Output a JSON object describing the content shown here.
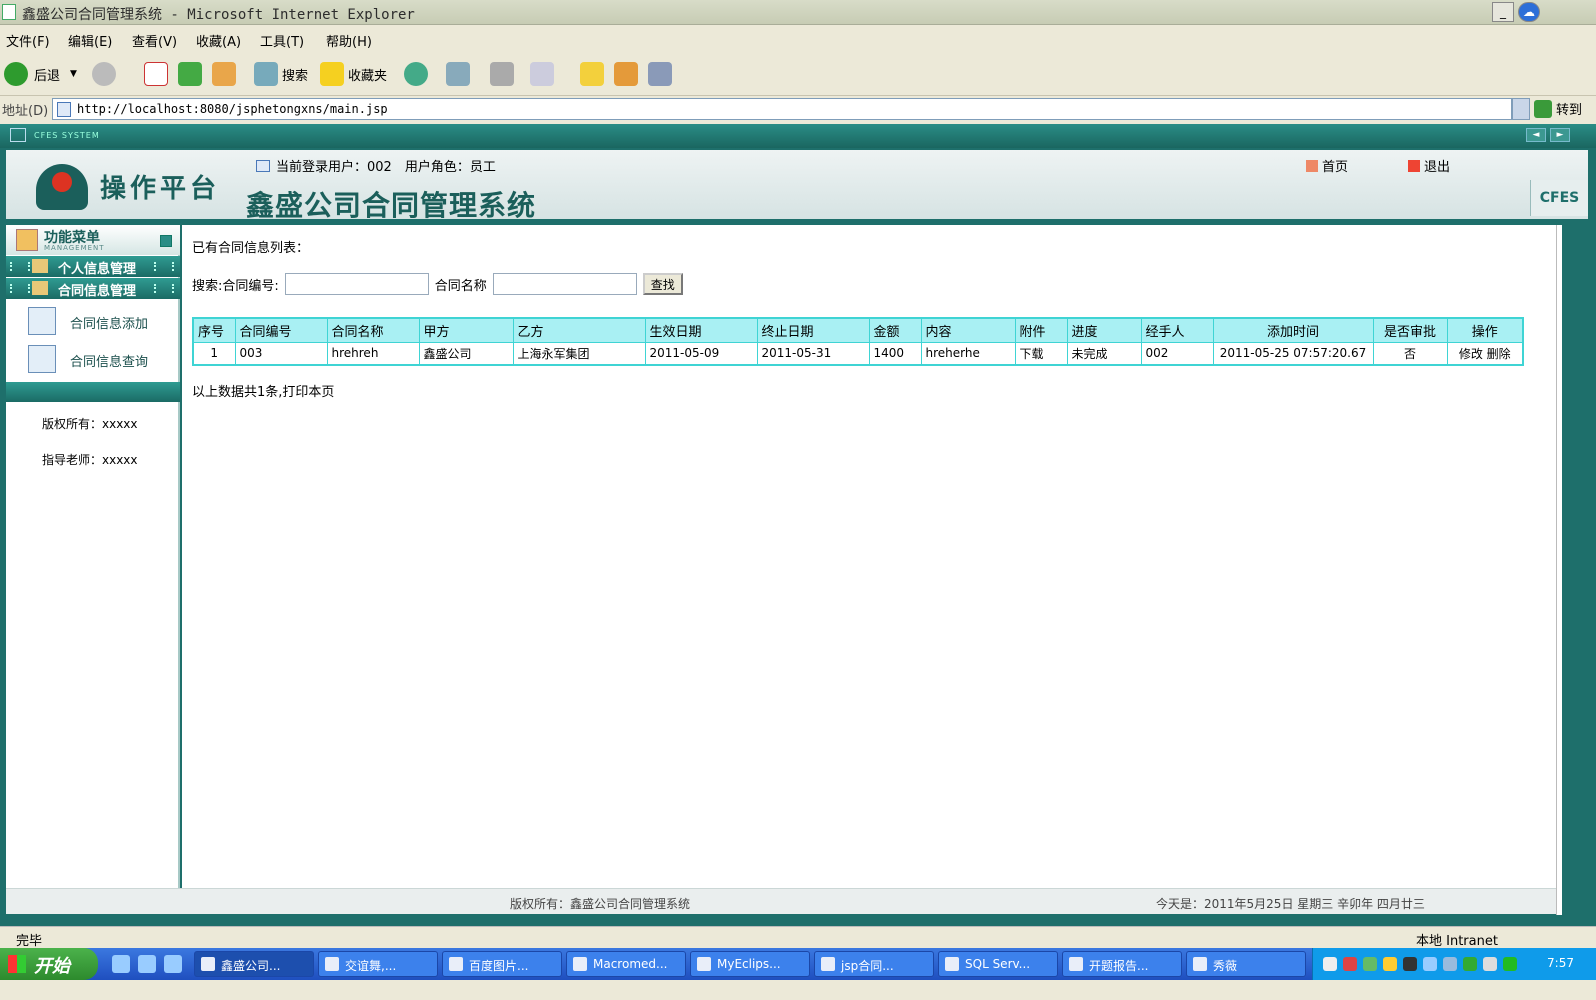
{
  "window": {
    "title": "鑫盛公司合同管理系统 - Microsoft Internet Explorer"
  },
  "menu": [
    "文件(F)",
    "编辑(E)",
    "查看(V)",
    "收藏(A)",
    "工具(T)",
    "帮助(H)"
  ],
  "toolbar": {
    "back": "后退",
    "search": "搜索",
    "favorites": "收藏夹"
  },
  "address": {
    "label": "地址(D)",
    "url": "http://localhost:8080/jsphetongxns/main.jsp",
    "go": "转到"
  },
  "cfes_bar": "CFES SYSTEM",
  "header": {
    "brand": "操作平台",
    "system_title": "鑫盛公司合同管理系统",
    "user_info": "当前登录用户：002　用户角色：员工",
    "home": "首页",
    "logout": "退出",
    "cfes": "CFES"
  },
  "sidebar": {
    "title": "功能菜单",
    "subtitle": "MANAGEMENT",
    "categories": [
      "个人信息管理",
      "合同信息管理"
    ],
    "items": [
      "合同信息添加",
      "合同信息查询"
    ],
    "copyright": "版权所有：xxxxx",
    "teacher": "指导老师：xxxxx"
  },
  "main": {
    "intro": "已有合同信息列表：",
    "search_label": "搜索:合同编号:",
    "name_label": "合同名称",
    "search_button": "查找",
    "summary": "以上数据共1条,打印本页",
    "columns": [
      "序号",
      "合同编号",
      "合同名称",
      "甲方",
      "乙方",
      "生效日期",
      "终止日期",
      "金额",
      "内容",
      "附件",
      "进度",
      "经手人",
      "添加时间",
      "是否审批",
      "操作"
    ],
    "rows": [
      [
        "1",
        "003",
        "hrehreh",
        "鑫盛公司",
        "上海永军集团",
        "2011-05-09",
        "2011-05-31",
        "1400",
        "hreherhe",
        "下载",
        "未完成",
        "002",
        "2011-05-25 07:57:20.67",
        "否"
      ]
    ],
    "actions": {
      "edit": "修改",
      "delete": "删除"
    }
  },
  "footer": {
    "copyright": "版权所有：鑫盛公司合同管理系统",
    "date": "今天是：2011年5月25日 星期三 辛卯年 四月廿三"
  },
  "ie_status": {
    "done": "完毕",
    "zone": "本地 Intranet"
  },
  "taskbar": {
    "start": "开始",
    "tasks": [
      "鑫盛公司...",
      "交谊舞,...",
      "百度图片...",
      "Macromed...",
      "MyEclips...",
      "jsp合同...",
      "SQL Serv...",
      "开题报告...",
      "秀薇"
    ],
    "clock": "7:57"
  }
}
